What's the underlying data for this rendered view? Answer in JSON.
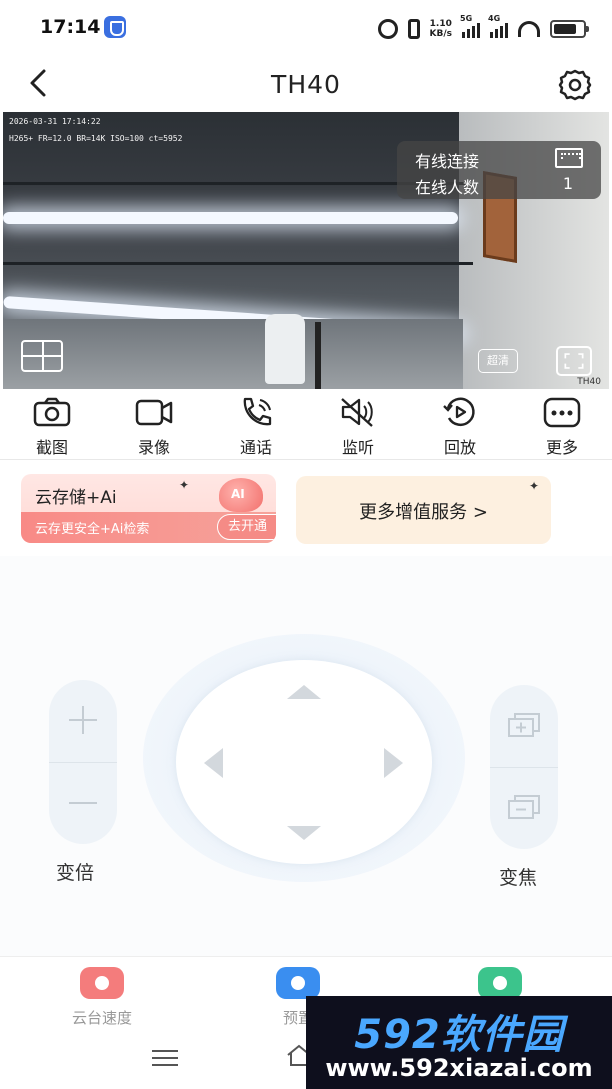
{
  "status_bar": {
    "time": "17:14",
    "net_speed": "1.10",
    "net_speed_unit": "KB/s",
    "sig1_label": "5G",
    "sig2_label": "4G"
  },
  "header": {
    "title": "TH40"
  },
  "video": {
    "osd_datetime": "2026-03-31 17:14:22",
    "osd_stats": "H265+ FR=12.0 BR=14K ISO=100 ct=5952",
    "connection_label": "有线连接",
    "online_label": "在线人数",
    "online_count": "1",
    "quality_label": "超清",
    "watermark": "TH40"
  },
  "toolbar": [
    {
      "label": "截图",
      "icon": "camera-icon"
    },
    {
      "label": "录像",
      "icon": "video-record-icon"
    },
    {
      "label": "通话",
      "icon": "phone-icon"
    },
    {
      "label": "监听",
      "icon": "speaker-mute-icon"
    },
    {
      "label": "回放",
      "icon": "playback-icon"
    },
    {
      "label": "更多",
      "icon": "more-icon"
    }
  ],
  "banners": {
    "cloud_title": "云存储+Ai",
    "cloud_desc": "云存更安全+Ai检索",
    "cloud_button": "去开通",
    "more_services": "更多增值服务 >"
  },
  "ptz": {
    "zoom_label": "变倍",
    "focus_label": "变焦"
  },
  "bottom_tabs": [
    {
      "label": "云台速度",
      "color": "#f47c7c"
    },
    {
      "label": "预置",
      "color": "#3a8ef0"
    },
    {
      "label": "",
      "color": "#3cc48c"
    }
  ],
  "site_watermark": {
    "brand": "592软件园",
    "url": "www.592xiazai.com"
  },
  "colors": {
    "accent_red": "#f58b86",
    "accent_blue": "#3a8ef0",
    "accent_green": "#3cc48c",
    "banner_cream": "#fdf0e0"
  }
}
